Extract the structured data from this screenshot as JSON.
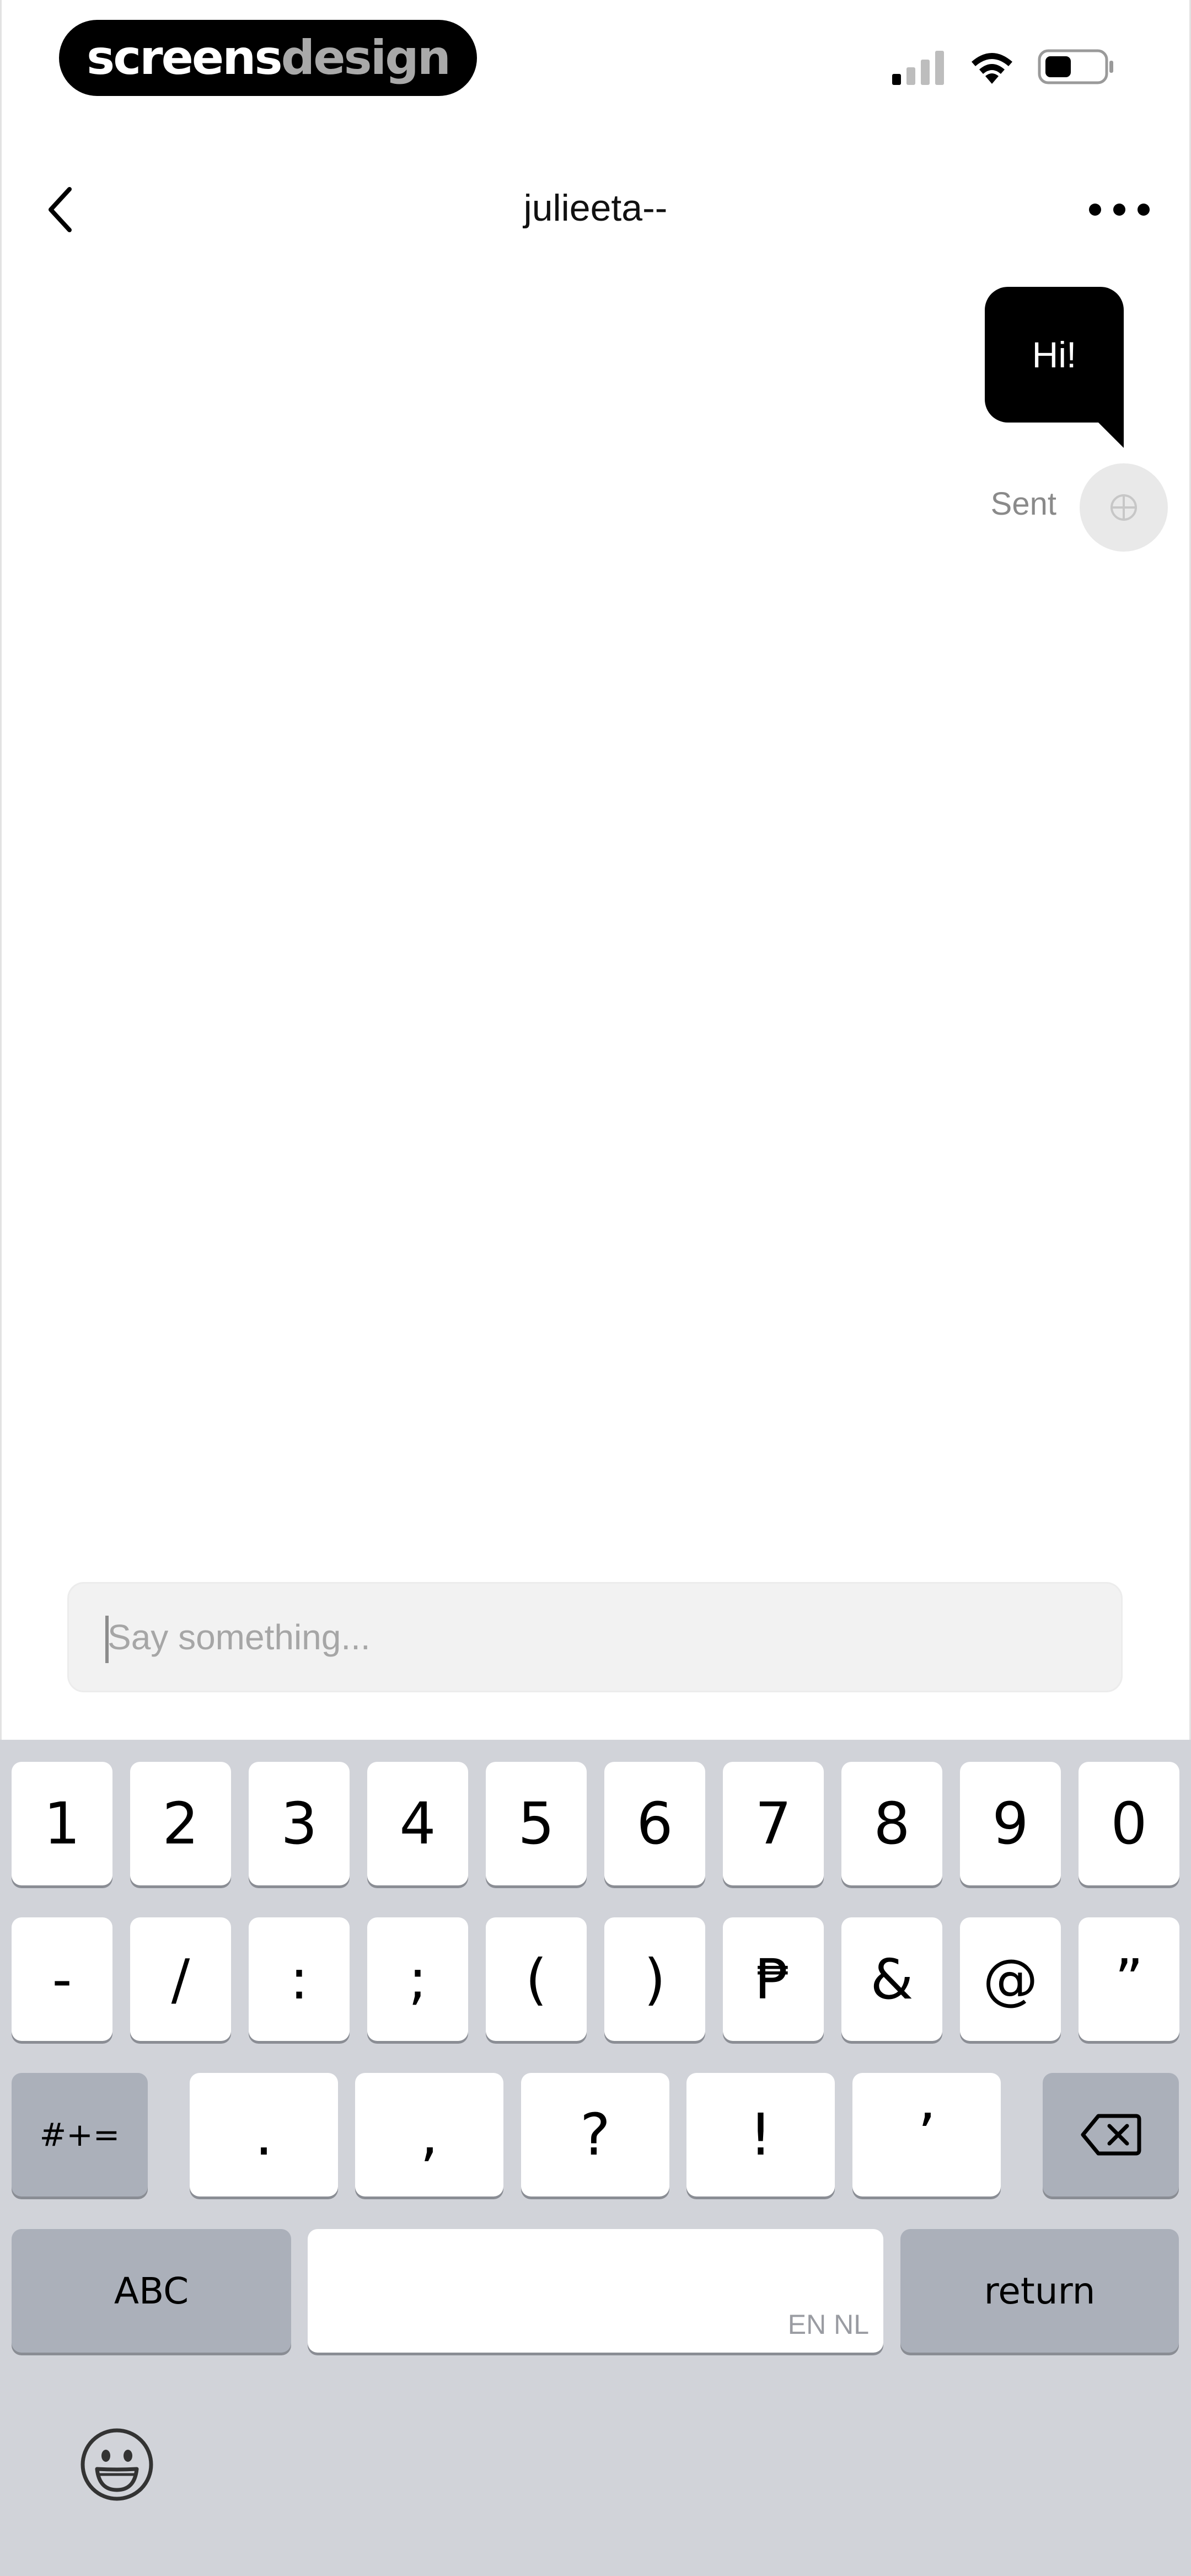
{
  "status_bar": {
    "brand_part1": "screens",
    "brand_part2": "design",
    "icons": [
      "signal-icon",
      "wifi-icon",
      "battery-icon"
    ]
  },
  "nav": {
    "title": "julieeta--",
    "back_icon": "chevron-left-icon",
    "more_icon": "more-horizontal-icon"
  },
  "messages": [
    {
      "text": "Hi!",
      "status": "Sent",
      "from": "me"
    }
  ],
  "composer": {
    "placeholder": "Say something...",
    "value": ""
  },
  "keyboard": {
    "row1": [
      "1",
      "2",
      "3",
      "4",
      "5",
      "6",
      "7",
      "8",
      "9",
      "0"
    ],
    "row2": [
      "-",
      "/",
      ":",
      ";",
      "(",
      ")",
      "₱",
      "&",
      "@",
      "”"
    ],
    "row3_modifier": "#+=",
    "row3": [
      ".",
      ",",
      "?",
      "!",
      "’"
    ],
    "backspace_icon": "backspace-icon",
    "abc_label": "ABC",
    "space_lang": "EN NL",
    "return_label": "return",
    "emoji_icon": "emoji-icon"
  },
  "colors": {
    "bubble": "#000000",
    "keyboard_bg": "#d1d3d9",
    "key_dark": "#abb0ba",
    "composer_bg": "#f2f2f2"
  }
}
